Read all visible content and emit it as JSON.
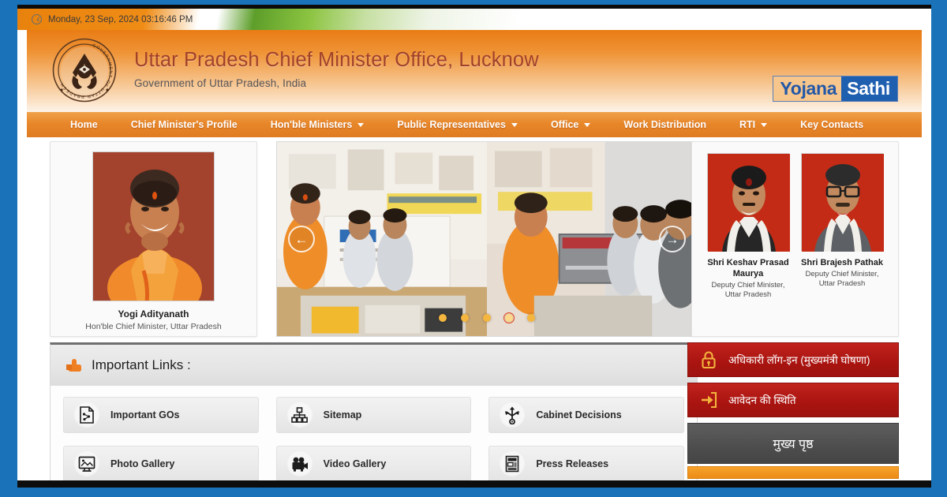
{
  "theme": {
    "frame_blue": "#1a72b8",
    "header_orange": "#e97c14",
    "nav_orange": "#e8862a",
    "title_color": "#a2412a",
    "red_button": "#ab1511",
    "gray_button": "#4d4d4d",
    "brand_blue": "#1f5fb0"
  },
  "topbar": {
    "datetime": "Monday, 23 Sep, 2024 03:16:46 PM",
    "clock_icon": "clock-icon"
  },
  "header": {
    "emblem_icon": "uttar-pradesh-government-emblem",
    "emblem_ring_text": "GOVERNMENT OF UTTAR PRADESH",
    "title": "Uttar Pradesh Chief Minister Office, Lucknow",
    "subtitle": "Government of Uttar Pradesh, India",
    "brand": {
      "part1": "Yojana",
      "part2": "Sathi"
    }
  },
  "nav": {
    "items": [
      {
        "label": "Home",
        "has_dropdown": false
      },
      {
        "label": "Chief Minister's Profile",
        "has_dropdown": false
      },
      {
        "label": "Hon'ble Ministers",
        "has_dropdown": true
      },
      {
        "label": "Public Representatives",
        "has_dropdown": true
      },
      {
        "label": "Office",
        "has_dropdown": true
      },
      {
        "label": "Work Distribution",
        "has_dropdown": false
      },
      {
        "label": "RTI",
        "has_dropdown": true
      },
      {
        "label": "Key Contacts",
        "has_dropdown": false
      }
    ]
  },
  "chief_minister": {
    "photo_alt": "yogi-adityanath-photo",
    "name": "Yogi Adityanath",
    "role": "Hon'ble Chief Minister, Uttar Pradesh"
  },
  "carousel": {
    "prev_icon": "←",
    "next_icon": "→",
    "slide_alt_1": "chief-minister-at-exhibition-stall",
    "slide_alt_2": "chief-minister-presenting-award-cheque",
    "dots": 5,
    "active_dot": 4
  },
  "deputy_ministers": [
    {
      "photo_alt": "keshav-prasad-maurya-photo",
      "name": "Shri Keshav Prasad Maurya",
      "role": "Deputy Chief Minister, Uttar Pradesh"
    },
    {
      "photo_alt": "brajesh-pathak-photo",
      "name": "Shri Brajesh Pathak",
      "role": "Deputy Chief Minister, Uttar Pradesh"
    }
  ],
  "important_links": {
    "heading": "Important Links :",
    "heading_icon": "pointing-hand-icon",
    "items": [
      {
        "label": "Important GOs",
        "icon": "document-chart-icon"
      },
      {
        "label": "Sitemap",
        "icon": "sitemap-icon"
      },
      {
        "label": "Cabinet Decisions",
        "icon": "arrows-hub-icon"
      },
      {
        "label": "Photo Gallery",
        "icon": "monitor-photo-icon"
      },
      {
        "label": "Video Gallery",
        "icon": "video-camera-icon"
      },
      {
        "label": "Press Releases",
        "icon": "newspaper-icon"
      }
    ]
  },
  "side_panel": {
    "officer_login": {
      "label": "अधिकारी लॉग-इन (मुख्यमंत्री घोषणा)",
      "icon": "lock-icon"
    },
    "application_status": {
      "label": "आवेदन की स्थिति",
      "icon": "login-arrow-icon"
    },
    "home_button": {
      "label": "मुख्य पृष्ठ"
    }
  }
}
